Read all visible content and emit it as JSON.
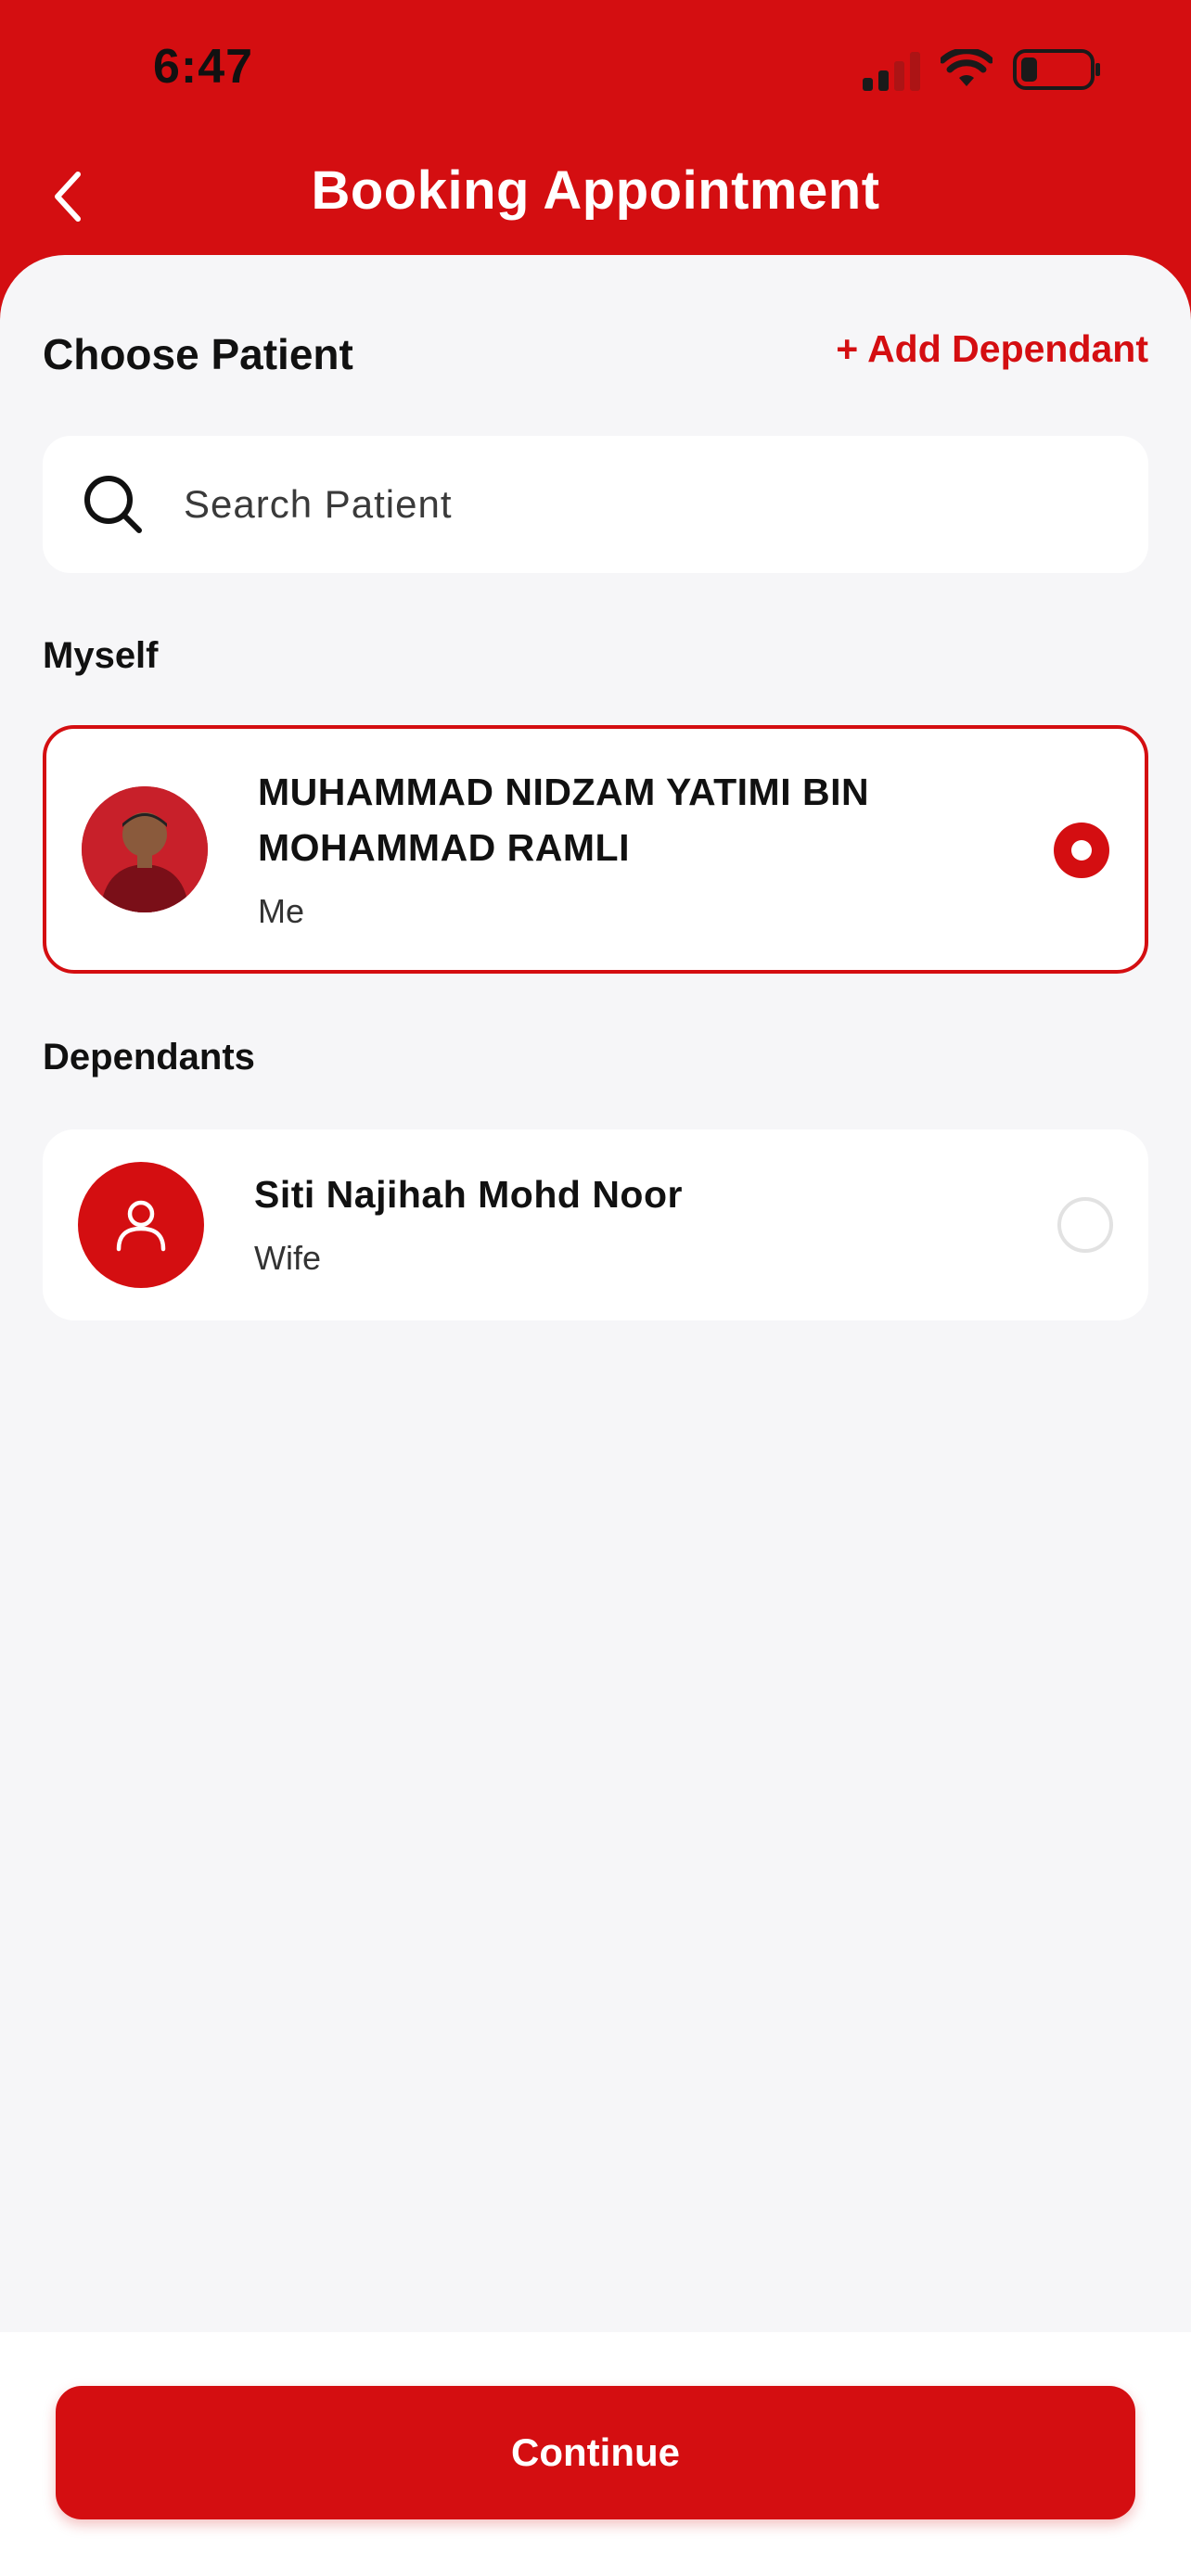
{
  "status_bar": {
    "time": "6:47"
  },
  "header": {
    "title": "Booking Appointment"
  },
  "choose_patient": {
    "title": "Choose Patient",
    "add_dependant_label": "+ Add Dependant",
    "search_placeholder": "Search Patient"
  },
  "myself": {
    "section_label": "Myself",
    "patient": {
      "name": "MUHAMMAD NIDZAM YATIMI BIN MOHAMMAD RAMLI",
      "relation": "Me",
      "selected": true
    }
  },
  "dependants": {
    "section_label": "Dependants",
    "items": [
      {
        "name": "Siti Najihah Mohd Noor",
        "relation": "Wife",
        "selected": false
      }
    ]
  },
  "footer": {
    "continue_label": "Continue"
  },
  "colors": {
    "brand": "#D40E11",
    "background": "#F6F6F8"
  }
}
